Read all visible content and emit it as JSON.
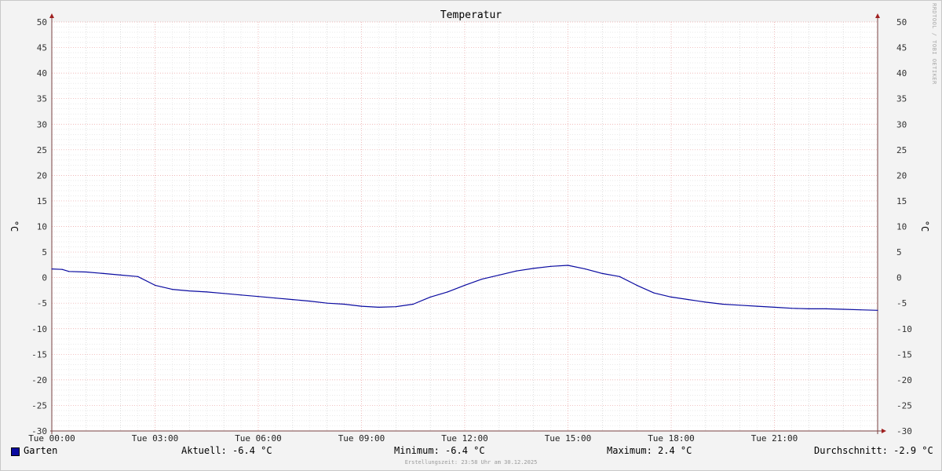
{
  "chart_data": {
    "type": "line",
    "title": "Temperatur",
    "ylabel": "°C",
    "ylim": [
      -30,
      50
    ],
    "yticks": [
      50,
      45,
      40,
      35,
      30,
      25,
      20,
      15,
      10,
      5,
      0,
      -5,
      -10,
      -15,
      -20,
      -25,
      -30
    ],
    "y_ticklabels_right": true,
    "xlim": [
      0,
      24
    ],
    "xticks": [
      {
        "x": 0,
        "label": "Tue 00:00"
      },
      {
        "x": 3,
        "label": "Tue 03:00"
      },
      {
        "x": 6,
        "label": "Tue 06:00"
      },
      {
        "x": 9,
        "label": "Tue 09:00"
      },
      {
        "x": 12,
        "label": "Tue 12:00"
      },
      {
        "x": 15,
        "label": "Tue 15:00"
      },
      {
        "x": 18,
        "label": "Tue 18:00"
      },
      {
        "x": 21,
        "label": "Tue 21:00"
      }
    ],
    "grid": true,
    "series": [
      {
        "name": "Garten",
        "color": "#0a0aa0",
        "x": [
          0,
          0.3,
          0.5,
          1,
          1.5,
          2,
          2.5,
          3,
          3.5,
          4,
          4.5,
          5,
          5.5,
          6,
          6.5,
          7,
          7.5,
          8,
          8.5,
          9,
          9.5,
          10,
          10.5,
          11,
          11.5,
          12,
          12.5,
          13,
          13.5,
          14,
          14.5,
          15,
          15.5,
          16,
          16.5,
          17,
          17.5,
          18,
          18.5,
          19,
          19.5,
          20,
          20.5,
          21,
          21.5,
          22,
          22.5,
          23,
          23.5,
          24
        ],
        "y": [
          1.7,
          1.6,
          1.2,
          1.1,
          0.8,
          0.5,
          0.2,
          -1.5,
          -2.3,
          -2.6,
          -2.8,
          -3.1,
          -3.4,
          -3.7,
          -4.0,
          -4.3,
          -4.6,
          -5.0,
          -5.2,
          -5.6,
          -5.8,
          -5.7,
          -5.2,
          -3.8,
          -2.8,
          -1.5,
          -0.3,
          0.5,
          1.3,
          1.8,
          2.2,
          2.4,
          1.7,
          0.8,
          0.2,
          -1.5,
          -3.0,
          -3.8,
          -4.3,
          -4.8,
          -5.2,
          -5.4,
          -5.6,
          -5.8,
          -6.0,
          -6.1,
          -6.1,
          -6.2,
          -6.3,
          -6.4
        ]
      }
    ]
  },
  "legend": {
    "series_name": "Garten",
    "current": "Aktuell: -6.4 °C",
    "minimum": "Minimum: -6.4 °C",
    "maximum": "Maximum: 2.4 °C",
    "average": "Durchschnitt: -2.9 °C"
  },
  "footer_note": "Erstellungszeit: 23:58 Uhr am 30.12.2025",
  "watermark": "RRDTOOL / TOBI OETIKER"
}
